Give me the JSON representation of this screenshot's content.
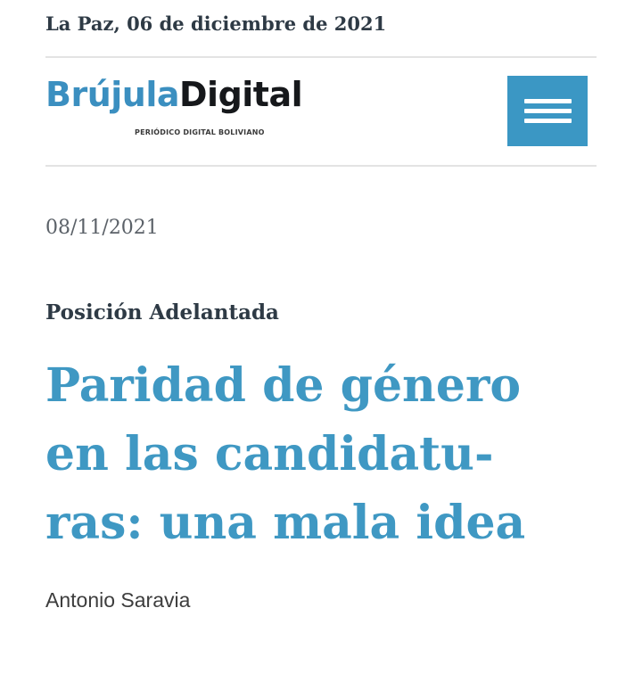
{
  "header": {
    "dateline": "La Paz, 06 de diciembre de 2021",
    "logo": {
      "part1": "Brújula",
      "part2": "Digital",
      "tagline": "PERIÓDICO DIGITAL BOLIVIANO"
    },
    "menu_icon": "hamburger-menu-icon"
  },
  "article": {
    "date": "08/11/2021",
    "section": "Posición Adelantada",
    "headline_lines": [
      "Paridad de género",
      "en las candidatu-",
      "ras: una mala idea"
    ],
    "author": "Antonio Saravia"
  },
  "colors": {
    "accent": "#3f98c3",
    "menu_bg": "#3b97c4",
    "dark_text": "#2e3a45"
  }
}
